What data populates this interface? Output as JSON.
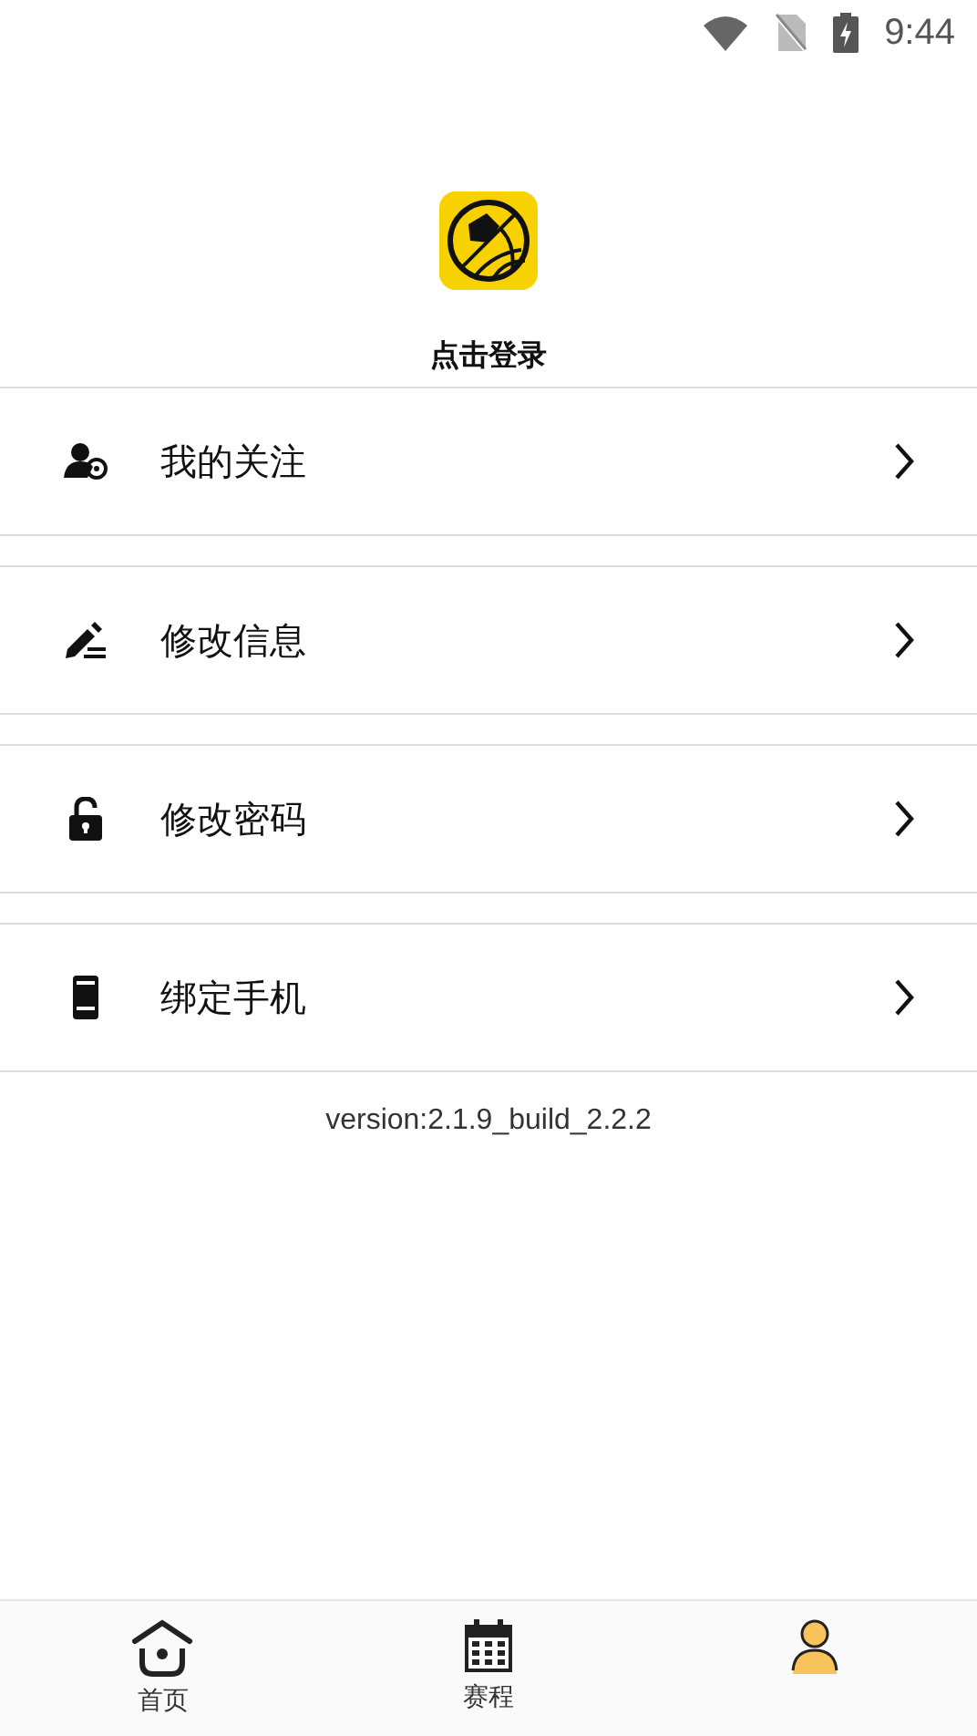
{
  "status_bar": {
    "time": "9:44"
  },
  "profile": {
    "login_label": "点击登录"
  },
  "menu": [
    {
      "kind": "follow",
      "label": "我的关注"
    },
    {
      "kind": "edit",
      "label": "修改信息"
    },
    {
      "kind": "password",
      "label": "修改密码"
    },
    {
      "kind": "phone",
      "label": "绑定手机"
    }
  ],
  "version": "version:2.1.9_build_2.2.2",
  "tabs": [
    {
      "kind": "home",
      "label": "首页",
      "selected": false
    },
    {
      "kind": "schedule",
      "label": "赛程",
      "selected": false
    },
    {
      "kind": "me",
      "selected": true
    }
  ]
}
